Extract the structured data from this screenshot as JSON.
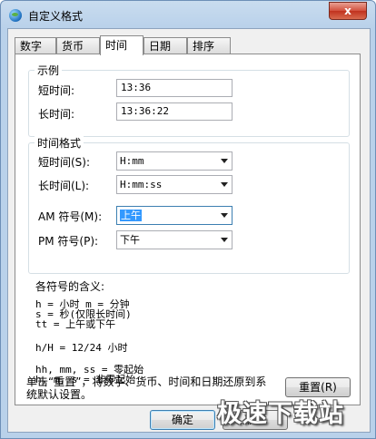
{
  "window": {
    "title": "自定义格式",
    "close_label": "x"
  },
  "tabs": [
    {
      "label": "数字",
      "active": false
    },
    {
      "label": "货币",
      "active": false
    },
    {
      "label": "时间",
      "active": true
    },
    {
      "label": "日期",
      "active": false
    },
    {
      "label": "排序",
      "active": false
    }
  ],
  "example": {
    "group_title": "示例",
    "short_label": "短时间:",
    "short_value": "13:36",
    "long_label": "长时间:",
    "long_value": "13:36:22"
  },
  "formats": {
    "group_title": "时间格式",
    "short_label": "短时间(S):",
    "short_value": "H:mm",
    "long_label": "长时间(L):",
    "long_value": "H:mm:ss",
    "am_label": "AM 符号(M):",
    "am_value": "上午",
    "pm_label": "PM 符号(P):",
    "pm_value": "下午"
  },
  "legend": {
    "title": "各符号的含义:",
    "lines": [
      "h = 小时   m = 分钟",
      "s = 秒(仅限长时间)",
      "tt = 上午或下午",
      "h/H = 12/24 小时",
      "hh, mm, ss = 零起始",
      "h, m, s = 非零起始"
    ]
  },
  "reset": {
    "text_line1": "单击“重置”，将数字、货币、时间和日期还原到系",
    "text_line2": "统默认设置。",
    "button_label": "重置(R)"
  },
  "footer": {
    "ok_label": "确定",
    "cancel_label": "取消"
  },
  "watermark": {
    "text": "极速下载站"
  }
}
